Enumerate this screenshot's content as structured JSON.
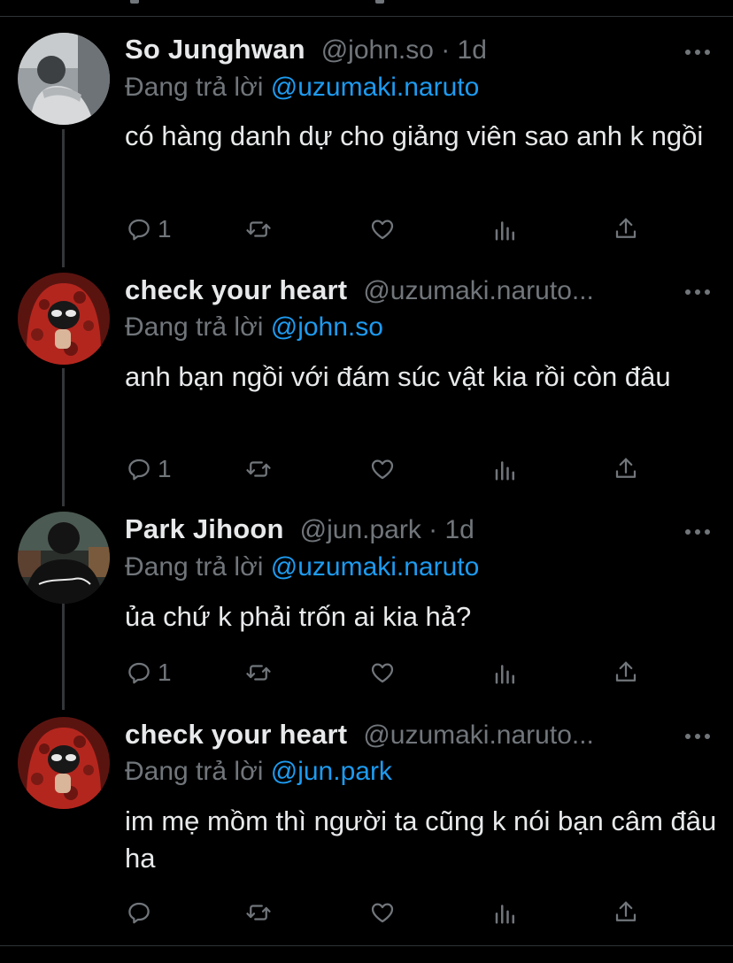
{
  "tweets": [
    {
      "name": "So Junghwan",
      "handle_time": "@john.so · 1d",
      "reply_prefix": "Đang trả lời ",
      "reply_to": "@uzumaki.naruto",
      "text": "có hàng danh dự cho giảng viên sao anh k ngồi",
      "reply_count": "1",
      "avatar_icon": "grey-photo-avatar"
    },
    {
      "name": "check your heart",
      "handle_time": "@uzumaki.naruto...",
      "reply_prefix": "Đang trả lời ",
      "reply_to": "@john.so",
      "text": "anh bạn ngồi với đám súc vật kia rồi còn đâu",
      "reply_count": "1",
      "avatar_icon": "red-hood-avatar"
    },
    {
      "name": "Park Jihoon",
      "handle_time": "@jun.park · 1d",
      "reply_prefix": "Đang trả lời ",
      "reply_to": "@uzumaki.naruto",
      "text": "ủa chứ k phải trốn ai kia hả?",
      "reply_count": "1",
      "avatar_icon": "dark-jacket-avatar"
    },
    {
      "name": "check your heart",
      "handle_time": "@uzumaki.naruto...",
      "reply_prefix": "Đang trả lời ",
      "reply_to": "@jun.park",
      "text": "im mẹ mồm thì người ta cũng k nói bạn câm đâu ha",
      "reply_count": "",
      "avatar_icon": "red-hood-avatar"
    }
  ],
  "colors": {
    "background": "#000000",
    "text": "#e7e9ea",
    "secondary": "#71767b",
    "mention": "#1d9bf0",
    "divider": "#2f3336"
  }
}
